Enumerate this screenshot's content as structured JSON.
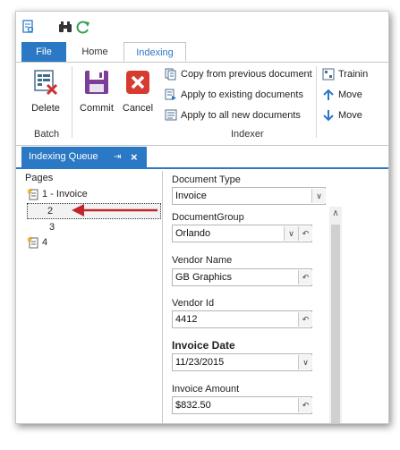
{
  "quick_access": {
    "icons": [
      "search-doc-icon",
      "binoculars-icon",
      "refresh-icon"
    ]
  },
  "ribbon_tabs": {
    "file": "File",
    "home": "Home",
    "indexing": "Indexing"
  },
  "ribbon": {
    "batch_group": {
      "label": "Batch",
      "delete": "Delete"
    },
    "commit": "Commit",
    "cancel": "Cancel",
    "indexer_group": {
      "label": "Indexer",
      "copy_prev": "Copy from previous document",
      "apply_existing": "Apply to existing documents",
      "apply_all_new": "Apply to all new documents",
      "training": "Trainin",
      "move_up": "Move",
      "move_down": "Move"
    }
  },
  "dock_tab": {
    "title": "Indexing Queue",
    "pin": "pin-icon",
    "close": "close-icon"
  },
  "pages": {
    "header": "Pages",
    "items": [
      {
        "label": "1 - Invoice",
        "icon": "new-page-icon"
      },
      {
        "label": "2",
        "icon": ""
      },
      {
        "label": "3",
        "icon": ""
      },
      {
        "label": "4",
        "icon": "new-page-icon"
      }
    ],
    "selected_index": 1
  },
  "form": {
    "document_type": {
      "label": "Document Type",
      "value": "Invoice"
    },
    "document_group": {
      "label": "DocumentGroup",
      "value": "Orlando"
    },
    "vendor_name": {
      "label": "Vendor Name",
      "value": "GB Graphics"
    },
    "vendor_id": {
      "label": "Vendor Id",
      "value": "4412"
    },
    "invoice_date": {
      "label": "Invoice Date",
      "value": "11/23/2015"
    },
    "invoice_amount": {
      "label": "Invoice Amount",
      "value": "$832.50"
    }
  },
  "colors": {
    "accent": "#2b78c5",
    "arrow": "#c0262c"
  }
}
